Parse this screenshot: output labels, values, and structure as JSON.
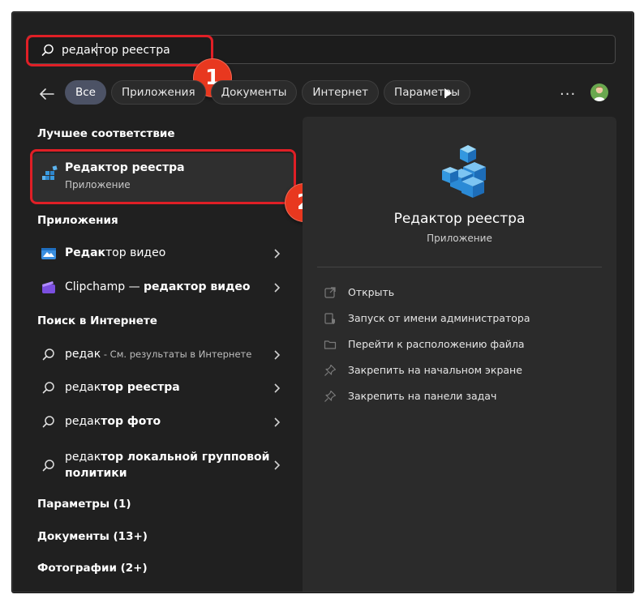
{
  "search": {
    "query_before_caret": "редак",
    "query_after_caret": "тор реестра"
  },
  "callouts": [
    "1",
    "2"
  ],
  "filters": {
    "chips": [
      "Все",
      "Приложения",
      "Документы",
      "Интернет",
      "Параметры"
    ],
    "active": "Все"
  },
  "best_match": {
    "header": "Лучшее соответствие",
    "title": "Редактор реестра",
    "subtitle": "Приложение"
  },
  "apps": {
    "header": "Приложения",
    "items": [
      {
        "bold": "Редак",
        "rest": "тор видео",
        "icon": "video-editor-icon"
      },
      {
        "pre": "Clipchamp — ",
        "bold": "редактор видео",
        "icon": "clipchamp-icon"
      }
    ]
  },
  "web": {
    "header": "Поиск в Интернете",
    "items": [
      {
        "plain": "редак",
        "muted": " - См. результаты в Интернете"
      },
      {
        "plain": "редак",
        "bold": "тор реестра"
      },
      {
        "plain": "редак",
        "bold": "тор фото"
      },
      {
        "plain": "редак",
        "bold": "тор локальной групповой",
        "bold2": "политики"
      }
    ]
  },
  "collapsed_sections": [
    "Параметры (1)",
    "Документы (13+)",
    "Фотографии (2+)"
  ],
  "detail": {
    "title": "Редактор реестра",
    "subtitle": "Приложение",
    "actions": [
      {
        "label": "Открыть",
        "icon": "open-icon"
      },
      {
        "label": "Запуск от имени администратора",
        "icon": "admin-shield-icon"
      },
      {
        "label": "Перейти к расположению файла",
        "icon": "folder-icon"
      },
      {
        "label": "Закрепить на начальном экране",
        "icon": "pin-icon"
      },
      {
        "label": "Закрепить на панели задач",
        "icon": "pin-icon"
      }
    ]
  },
  "colors": {
    "background": "#202020",
    "panel": "#2b2b2b",
    "active_chip": "#4c5265",
    "highlight_red": "#e01f26",
    "badge_orange": "#e8381f",
    "registry_blue": "#2e8fd8"
  }
}
